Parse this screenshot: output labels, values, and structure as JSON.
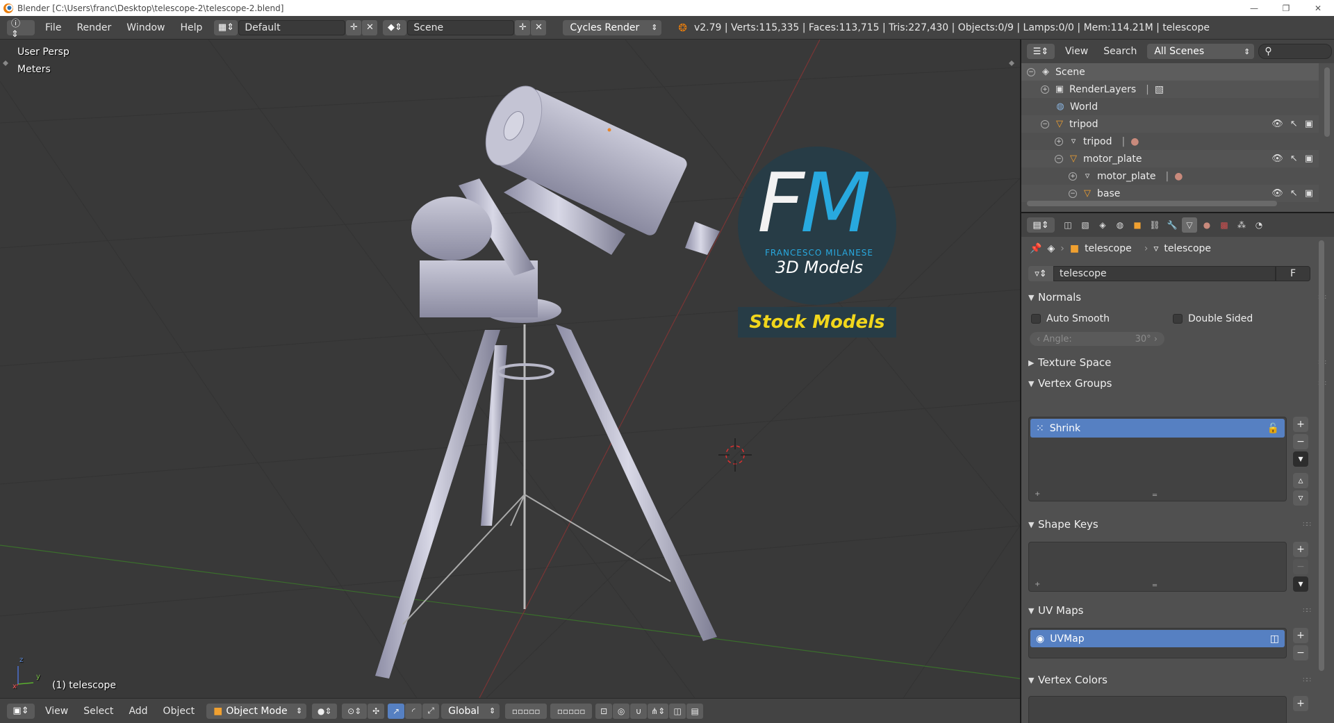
{
  "window": {
    "title": "Blender [C:\\Users\\franc\\Desktop\\telescope-2\\telescope-2.blend]",
    "controls": [
      "—",
      "❐",
      "✕"
    ]
  },
  "info_header": {
    "menus": [
      "File",
      "Render",
      "Window",
      "Help"
    ],
    "screen_layout": "Default",
    "scene": "Scene",
    "render_engine": "Cycles Render",
    "stats": "v2.79 | Verts:115,335 | Faces:113,715 | Tris:227,430 | Objects:0/9 | Lamps:0/0 | Mem:114.21M | telescope"
  },
  "viewport": {
    "view_name": "User Persp",
    "units": "Meters",
    "object_label": "(1) telescope",
    "axis_x": "x",
    "axis_y": "y",
    "axis_z": "z",
    "watermark": {
      "letter_f": "F",
      "letter_m": "M",
      "author": "FRANCESCO MILANESE",
      "subtitle": "3D Models",
      "banner": "Stock Models"
    }
  },
  "viewport_header": {
    "menus": [
      "View",
      "Select",
      "Add",
      "Object"
    ],
    "mode": "Object Mode",
    "orientation": "Global"
  },
  "outliner": {
    "menus": [
      "View",
      "Search"
    ],
    "filter": "All Scenes",
    "rows": [
      {
        "label": "Scene",
        "icon": "scene-icon"
      },
      {
        "label": "RenderLayers",
        "icon": "render-layers-icon"
      },
      {
        "label": "World",
        "icon": "world-icon"
      },
      {
        "label": "tripod",
        "icon": "object-icon"
      },
      {
        "label": "tripod",
        "icon": "mesh-icon"
      },
      {
        "label": "motor_plate",
        "icon": "object-icon"
      },
      {
        "label": "motor_plate",
        "icon": "mesh-icon"
      },
      {
        "label": "base",
        "icon": "object-icon"
      }
    ]
  },
  "properties": {
    "breadcrumb_object": "telescope",
    "breadcrumb_data": "telescope",
    "datablock_name": "telescope",
    "datablock_fake_user": "F",
    "normals": {
      "title": "Normals",
      "auto_smooth": "Auto Smooth",
      "double_sided": "Double Sided",
      "angle_label": "Angle:",
      "angle_value": "30°"
    },
    "texture_space": "Texture Space",
    "vertex_groups": {
      "title": "Vertex Groups",
      "items": [
        "Shrink"
      ]
    },
    "shape_keys": {
      "title": "Shape Keys"
    },
    "uv_maps": {
      "title": "UV Maps",
      "items": [
        "UVMap"
      ]
    },
    "vertex_colors": {
      "title": "Vertex Colors"
    }
  },
  "colors": {
    "accent_selection": "#5680c2",
    "logo_blue": "#28a9df",
    "logo_yellow": "#f1d61c",
    "viewport_bg": "#393939"
  }
}
